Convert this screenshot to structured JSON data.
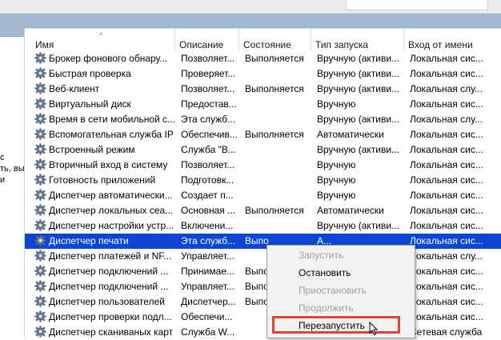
{
  "window": {
    "side_text": [
      "с",
      "ть, вы",
      "и"
    ]
  },
  "columns": {
    "name": "Имя",
    "description": "Описание",
    "state": "Состояние",
    "startup": "Тип запуска",
    "logon": "Вход от имени"
  },
  "services": [
    {
      "name": "Брокер фонового обнару...",
      "description": "Позволяет...",
      "state": "Выполняется",
      "startup": "Вручную (активи...",
      "logon": "Локальная сис..."
    },
    {
      "name": "Быстрая проверка",
      "description": "Проверяет...",
      "state": "",
      "startup": "Вручную (активи...",
      "logon": "Локальная сис..."
    },
    {
      "name": "Веб-клиент",
      "description": "Позволяет...",
      "state": "Выполняется",
      "startup": "Вручную (активи...",
      "logon": "Локальная слу..."
    },
    {
      "name": "Виртуальный диск",
      "description": "Предостав...",
      "state": "",
      "startup": "Вручную",
      "logon": "Локальная сис..."
    },
    {
      "name": "Время в сети мобильной с...",
      "description": "Эта служб...",
      "state": "",
      "startup": "Вручную (активи...",
      "logon": "Локальная слу..."
    },
    {
      "name": "Вспомогательная служба IP",
      "description": "Обеспечив...",
      "state": "Выполняется",
      "startup": "Автоматически",
      "logon": "Локальная сис..."
    },
    {
      "name": "Встроенный режим",
      "description": "Служба \"В...",
      "state": "",
      "startup": "Вручную (активи...",
      "logon": "Локальная сис..."
    },
    {
      "name": "Вторичный вход в систему",
      "description": "Позволяет...",
      "state": "",
      "startup": "Вручную",
      "logon": "Локальная сис..."
    },
    {
      "name": "Готовность приложений",
      "description": "Подготовк...",
      "state": "",
      "startup": "Вручную",
      "logon": "Локальная сис..."
    },
    {
      "name": "Диспетчер автоматически...",
      "description": "Создает п...",
      "state": "",
      "startup": "Вручную",
      "logon": "Локальная сис..."
    },
    {
      "name": "Диспетчер локальных сеа...",
      "description": "Основная ...",
      "state": "Выполняется",
      "startup": "Автоматически",
      "logon": "Локальная сис..."
    },
    {
      "name": "Диспетчер настройки устр...",
      "description": "Включени...",
      "state": "",
      "startup": "Вручную (активи...",
      "logon": "Локальная сис..."
    },
    {
      "name": "Диспетчер печати",
      "description": "Эта служб...",
      "state": "Выпо",
      "startup": "А...",
      "logon": "Локальная сис...",
      "selected": true
    },
    {
      "name": "Диспетчер платежей и NF...",
      "description": "Управляет...",
      "state": "",
      "startup": "",
      "logon": "Локальная слу..."
    },
    {
      "name": "Диспетчер подключений ...",
      "description": "Принимае...",
      "state": "Выпо",
      "startup": "",
      "logon": "Локальная сис..."
    },
    {
      "name": "Диспетчер подключений ...",
      "description": "Управляет...",
      "state": "Выпо",
      "startup": "",
      "logon": "Локальная сис..."
    },
    {
      "name": "Диспетчер пользователей",
      "description": "Диспетчер...",
      "state": "Выпо",
      "startup": "",
      "logon": "Локальная сис..."
    },
    {
      "name": "Диспетчер проверки подл...",
      "description": "Обеспечи...",
      "state": "",
      "startup": "",
      "logon": "Локальная сис..."
    },
    {
      "name": "Диспетчер сканиваных карт",
      "description": "Служба W...",
      "state": "",
      "startup": "",
      "logon": "Сетевая служба"
    }
  ],
  "context_menu": {
    "items": [
      {
        "label": "Запустить",
        "disabled": true
      },
      {
        "label": "Остановить",
        "disabled": false
      },
      {
        "label": "Приостановить",
        "disabled": true
      },
      {
        "label": "Продолжить",
        "disabled": true
      },
      {
        "label": "Перезапустить",
        "disabled": false
      }
    ]
  },
  "icons": {
    "service": "gear-icon",
    "cursor": "mouse-pointer-icon"
  },
  "colors": {
    "selection": "#0a46d1",
    "highlight_box": "#e0442c",
    "title_band": "#a3b9cf"
  }
}
